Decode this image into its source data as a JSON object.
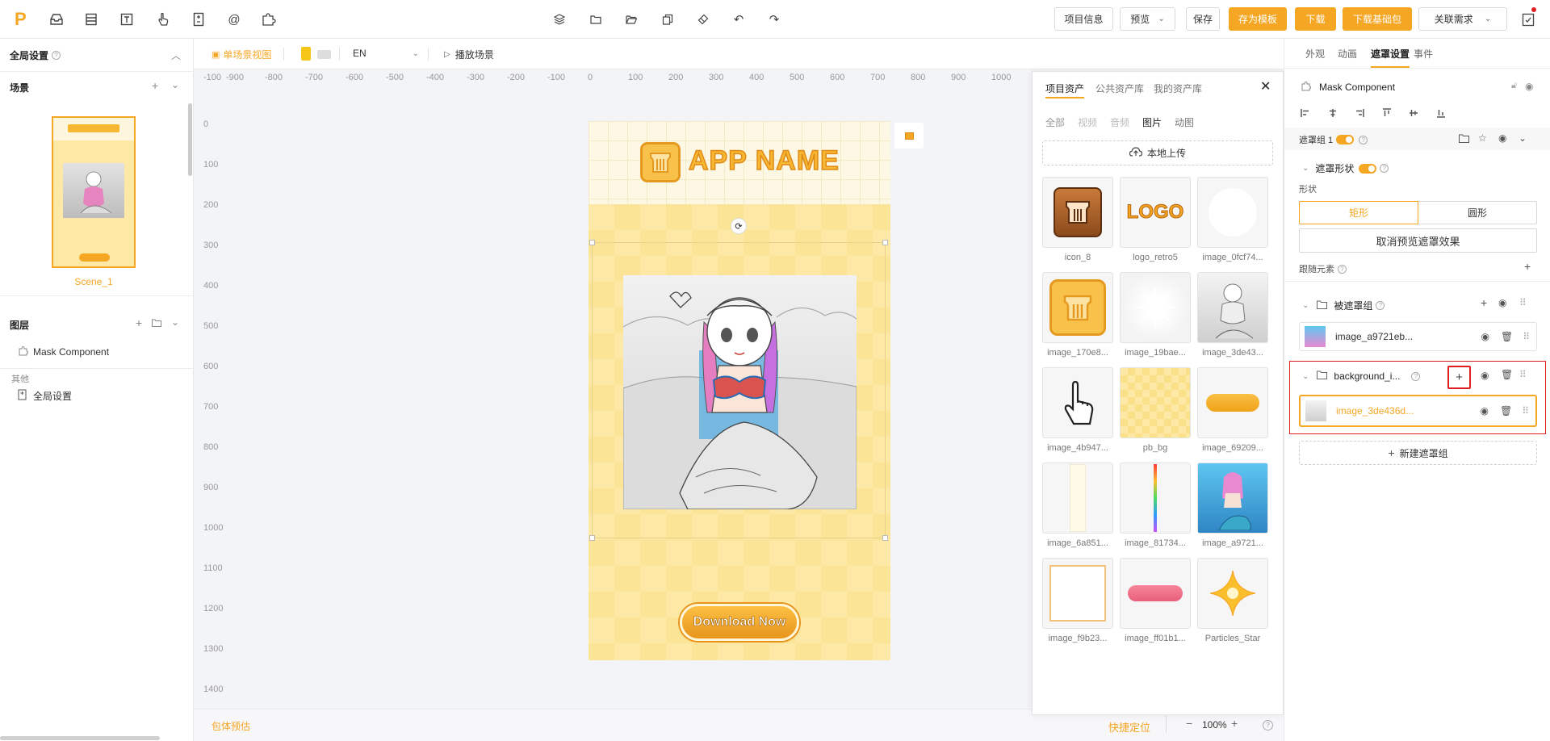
{
  "topbar": {
    "logo": "P",
    "center_icons": [
      "layers-icon",
      "folder-icon",
      "folder-open-icon",
      "copy-icon",
      "eraser-icon",
      "undo-icon",
      "redo-icon"
    ],
    "buttons": {
      "project_info": "项目信息",
      "preview": "预览",
      "save": "保存",
      "save_template": "存为模板",
      "download": "下载",
      "download_basic": "下载基础包",
      "related_needs": "关联需求"
    }
  },
  "left": {
    "global_settings": "全局设置",
    "scene_section": "场景",
    "scene_name": "Scene_1",
    "layer_section": "图层",
    "layer_item": "Mask Component",
    "other_section": "其他",
    "other_item": "全局设置"
  },
  "canvas": {
    "view_mode": "单场景视图",
    "language": "EN",
    "play_scene": "播放场景",
    "ruler_h": [
      "-100",
      "-900",
      "-800",
      "-700",
      "-600",
      "-500",
      "-400",
      "-300",
      "-200",
      "-100",
      "0",
      "100",
      "200",
      "300",
      "400",
      "500",
      "600",
      "700",
      "800",
      "900",
      "1000"
    ],
    "ruler_v": [
      "0",
      "100",
      "200",
      "300",
      "400",
      "500",
      "600",
      "700",
      "800",
      "900",
      "1000",
      "1100",
      "1200",
      "1300",
      "1400"
    ],
    "app_name": "APP NAME",
    "cta": "Download Now",
    "footer_left": "包体预估",
    "quick_locate": "快捷定位",
    "zoom": "100%",
    "zoom_minus": "−",
    "zoom_plus": "+"
  },
  "assets": {
    "tabs": [
      "项目资产",
      "公共资产库",
      "我的资产库"
    ],
    "filters": [
      "全部",
      "视频",
      "音频",
      "图片",
      "动图"
    ],
    "upload": "本地上传",
    "items": [
      {
        "name": "icon_8",
        "kind": "icon8"
      },
      {
        "name": "logo_retro5",
        "kind": "logo"
      },
      {
        "name": "image_0fcf74...",
        "kind": "circle"
      },
      {
        "name": "image_170e8...",
        "kind": "icon8light"
      },
      {
        "name": "image_19bae...",
        "kind": "burst"
      },
      {
        "name": "image_3de43...",
        "kind": "sketch"
      },
      {
        "name": "image_4b947...",
        "kind": "hand"
      },
      {
        "name": "pb_bg",
        "kind": "checker"
      },
      {
        "name": "image_69209...",
        "kind": "pill-orange"
      },
      {
        "name": "image_6a851...",
        "kind": "strip"
      },
      {
        "name": "image_81734...",
        "kind": "rainbow"
      },
      {
        "name": "image_a9721...",
        "kind": "mermaid"
      },
      {
        "name": "image_f9b23...",
        "kind": "frame"
      },
      {
        "name": "image_ff01b1...",
        "kind": "pill-pink"
      },
      {
        "name": "Particles_Star",
        "kind": "star"
      }
    ]
  },
  "right": {
    "tabs": [
      "外观",
      "动画",
      "遮罩设置",
      "事件"
    ],
    "component": "Mask Component",
    "mask_group": "遮罩组 1",
    "mask_shape": "遮罩形状",
    "shape_label": "形状",
    "shape_rect": "矩形",
    "shape_circle": "圆形",
    "cancel_preview": "取消预览遮罩效果",
    "follow_element": "跟随元素",
    "masked_group": "被遮罩组",
    "masked_item": "image_a9721eb...",
    "bg_group": "background_i...",
    "bg_item": "image_3de436d...",
    "new_mask_group": "新建遮罩组"
  },
  "colors": {
    "accent": "#f5a623",
    "selection": "#e02020"
  }
}
